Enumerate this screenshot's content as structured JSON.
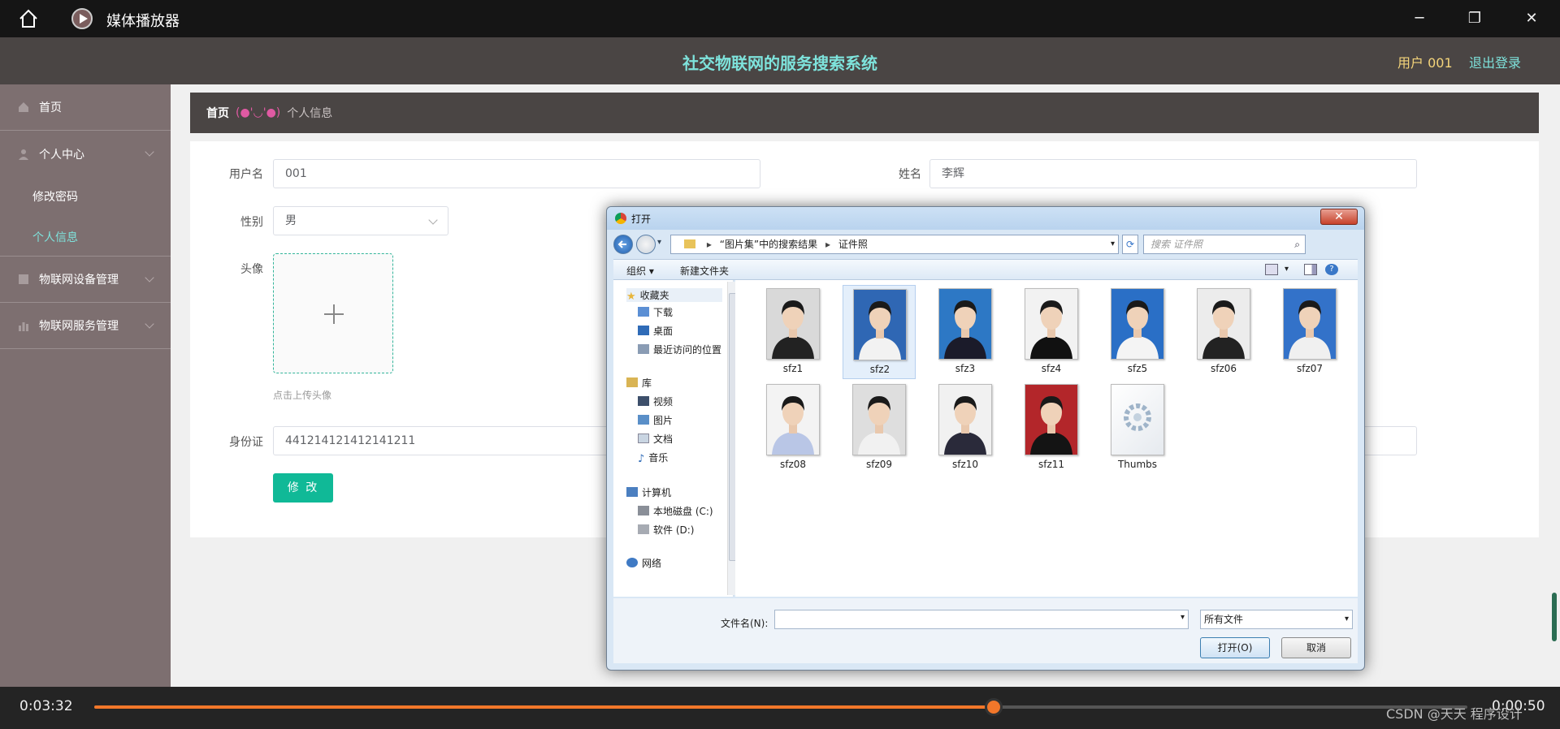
{
  "player": {
    "title": "媒体播放器",
    "current_time": "0:03:32",
    "total_time": "0:00:50",
    "progress": 0.655,
    "watermark": "CSDN @天天 程序设计"
  },
  "app": {
    "system_title": "社交物联网的服务搜索系统",
    "user": "用户 001",
    "logout": "退出登录"
  },
  "sidebar": {
    "items": [
      {
        "label": "首页"
      },
      {
        "label": "个人中心"
      },
      {
        "label": "物联网设备管理"
      },
      {
        "label": "物联网服务管理"
      }
    ],
    "sub": [
      {
        "label": "修改密码"
      },
      {
        "label": "个人信息"
      }
    ]
  },
  "breadcrumb": {
    "home": "首页",
    "separator": "(●'◡'●)",
    "current": "个人信息"
  },
  "form": {
    "username_label": "用户名",
    "username_value": "001",
    "name_label": "姓名",
    "name_value": "李辉",
    "gender_label": "性别",
    "gender_value": "男",
    "avatar_label": "头像",
    "upload_hint": "点击上传头像",
    "id_label": "身份证",
    "id_value": "441214121412141211",
    "submit_label": "修 改"
  },
  "dialog": {
    "title": "打开",
    "close": "✕",
    "path": [
      "“图片集”中的搜索结果",
      "证件照"
    ],
    "search_placeholder": "搜索 证件照",
    "toolbar_organize": "组织 ▾",
    "toolbar_newfolder": "新建文件夹",
    "nav": {
      "favorites": "收藏夹",
      "downloads": "下载",
      "desktop": "桌面",
      "recent": "最近访问的位置",
      "libraries": "库",
      "videos": "视频",
      "pictures": "图片",
      "documents": "文档",
      "music": "音乐",
      "computer": "计算机",
      "drive_c": "本地磁盘 (C:)",
      "drive_d": "软件 (D:)",
      "network": "网络"
    },
    "files": [
      {
        "name": "sfz1",
        "bg": "#d9d9d9",
        "shirt": "#222"
      },
      {
        "name": "sfz2",
        "bg": "#2f67b4",
        "shirt": "#f2f2f2"
      },
      {
        "name": "sfz3",
        "bg": "#2d78c5",
        "shirt": "#1b1b2a"
      },
      {
        "name": "sfz4",
        "bg": "#f2f2f2",
        "shirt": "#111"
      },
      {
        "name": "sfz5",
        "bg": "#2a6fc6",
        "shirt": "#f4f4f4"
      },
      {
        "name": "sfz06",
        "bg": "#ececec",
        "shirt": "#222"
      },
      {
        "name": "sfz07",
        "bg": "#3372c9",
        "shirt": "#f0f0f0"
      },
      {
        "name": "sfz08",
        "bg": "#f3f3f3",
        "shirt": "#b9c6e6"
      },
      {
        "name": "sfz09",
        "bg": "#dedede",
        "shirt": "#f1f1f1"
      },
      {
        "name": "sfz10",
        "bg": "#f1f1f1",
        "shirt": "#2a2a3a"
      },
      {
        "name": "sfz11",
        "bg": "#b3262a",
        "shirt": "#141414"
      },
      {
        "name": "Thumbs",
        "bg": "#ffffff",
        "shirt": "#ffffff"
      }
    ],
    "filename_label": "文件名(N):",
    "filetype_value": "所有文件",
    "open_button": "打开(O)",
    "cancel_button": "取消"
  },
  "colors": {
    "accent_teal": "#10b997",
    "header_title": "#7ee3dc",
    "user_yellow": "#f4d47a",
    "progress_orange": "#f2772a"
  }
}
